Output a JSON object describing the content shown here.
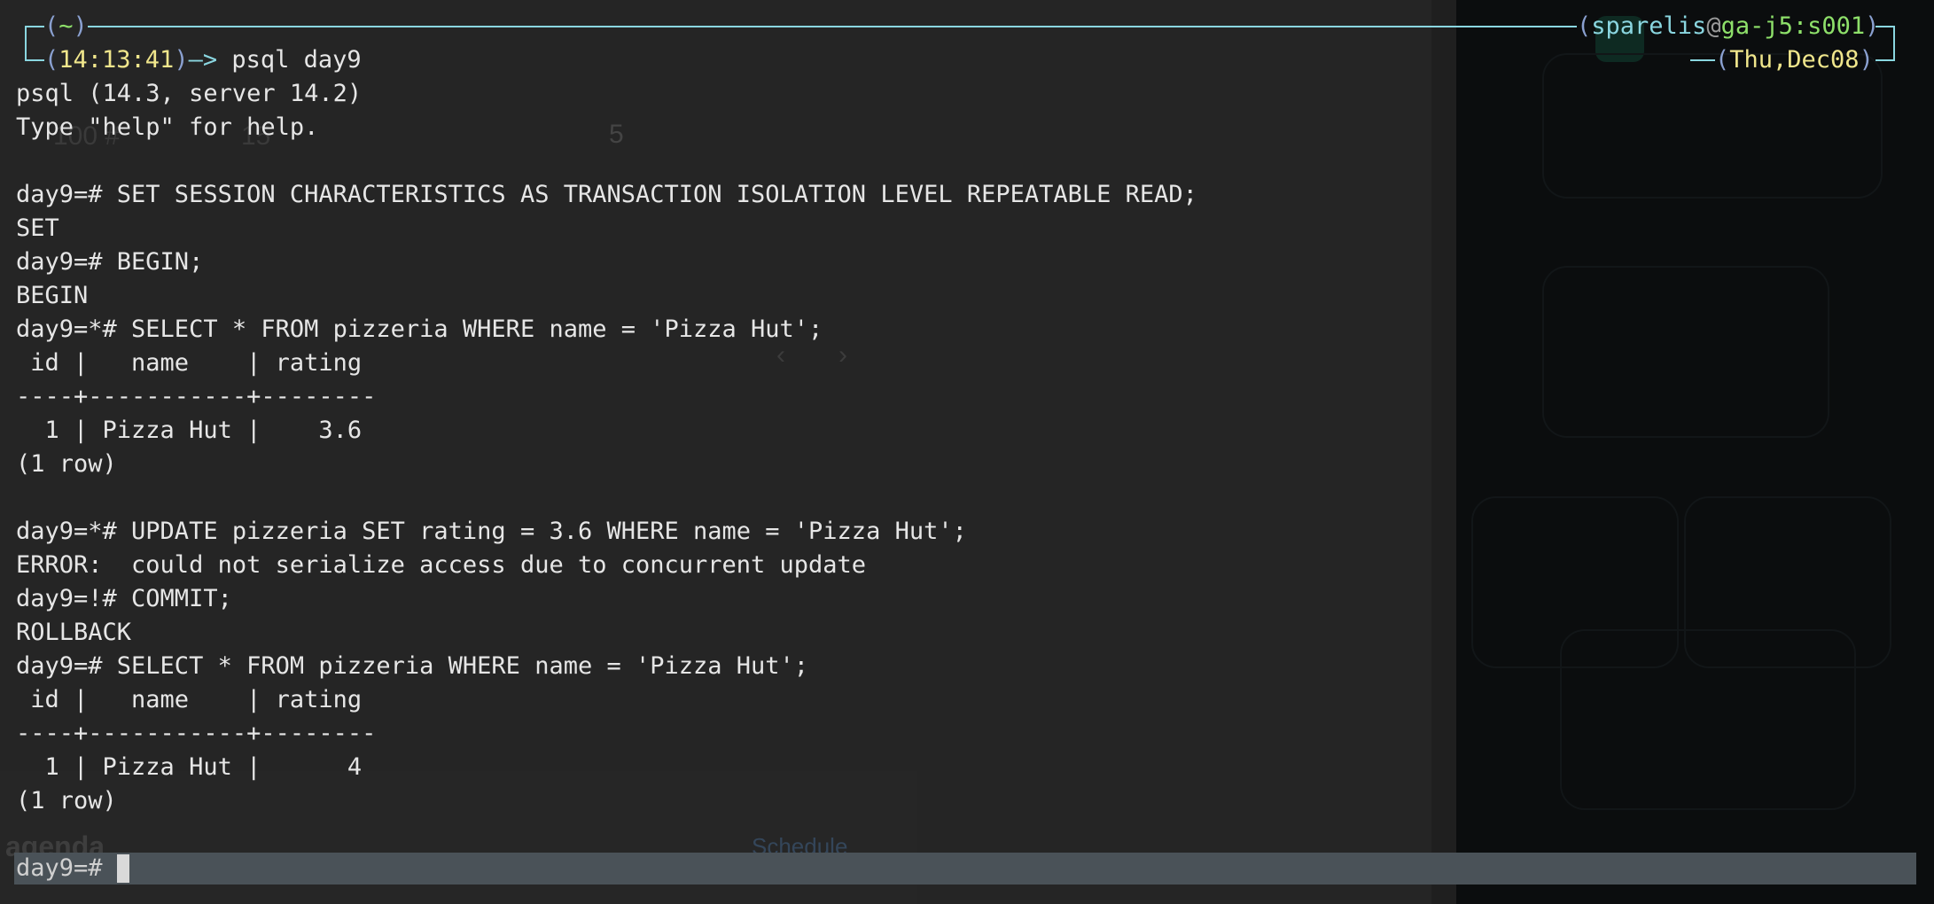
{
  "prompt": {
    "dir": "~",
    "time": "14:13:41",
    "command": "psql day9",
    "user": "sparelis",
    "host": "ga-j5:s001",
    "date": "Thu,Dec08"
  },
  "output": [
    "psql (14.3, server 14.2)",
    "Type \"help\" for help.",
    "",
    "day9=# SET SESSION CHARACTERISTICS AS TRANSACTION ISOLATION LEVEL REPEATABLE READ;",
    "SET",
    "day9=# BEGIN;",
    "BEGIN",
    "day9=*# SELECT * FROM pizzeria WHERE name = 'Pizza Hut';",
    " id |   name    | rating",
    "----+-----------+--------",
    "  1 | Pizza Hut |    3.6",
    "(1 row)",
    "",
    "day9=*# UPDATE pizzeria SET rating = 3.6 WHERE name = 'Pizza Hut';",
    "ERROR:  could not serialize access due to concurrent update",
    "day9=!# COMMIT;",
    "ROLLBACK",
    "day9=# SELECT * FROM pizzeria WHERE name = 'Pizza Hut';",
    " id |   name    | rating",
    "----+-----------+--------",
    "  1 | Pizza Hut |      4",
    "(1 row)"
  ],
  "input": {
    "prompt": "day9=# ",
    "value": ""
  },
  "background": {
    "number_a": "100 #",
    "number_b": "15",
    "number_c": "5",
    "agenda": "agenda",
    "schedule": "Schedule",
    "nav_prev": "‹",
    "nav_next": "›"
  }
}
